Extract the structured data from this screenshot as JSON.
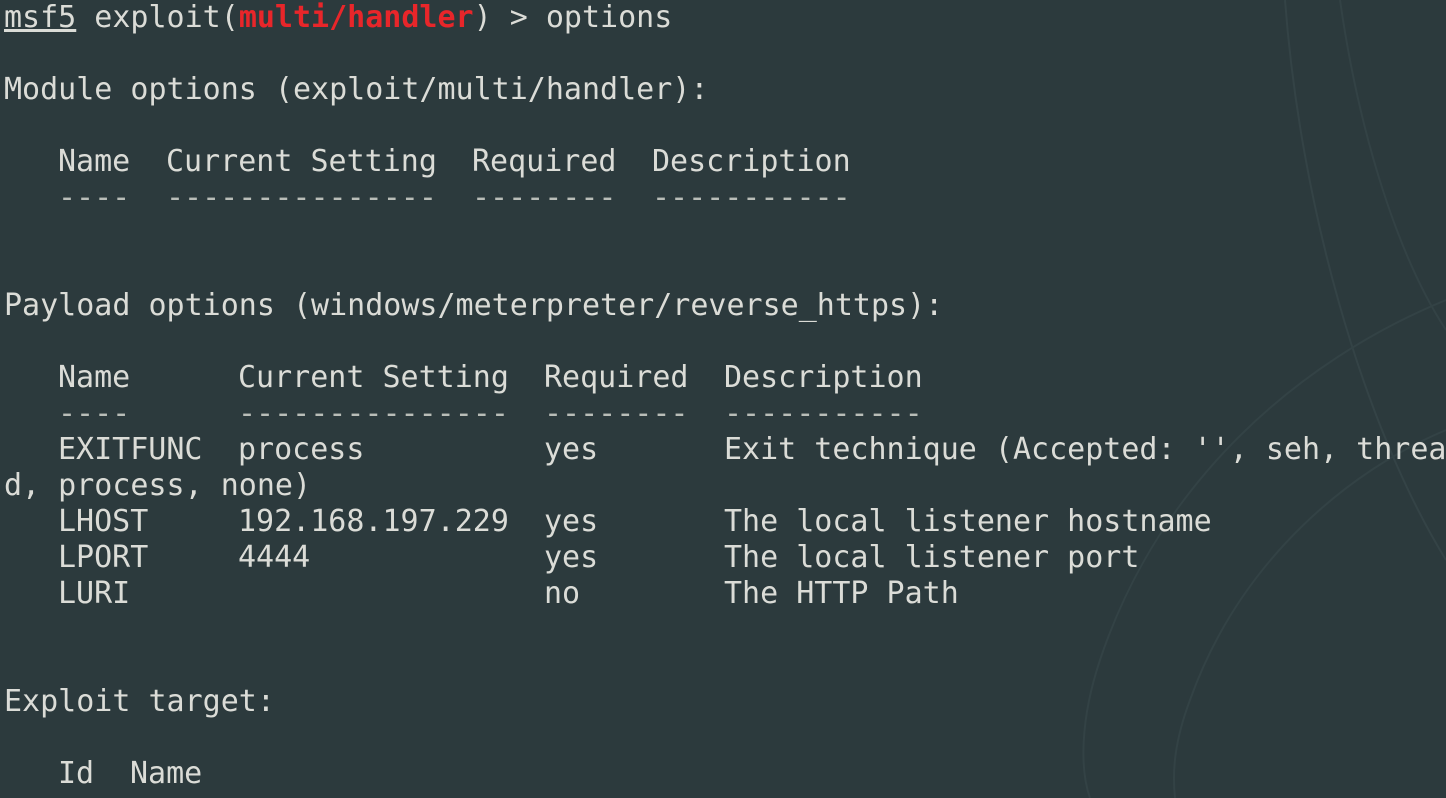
{
  "prompt": {
    "name": "msf5",
    "context_prefix": " exploit(",
    "module": "multi/handler",
    "context_suffix": ") > ",
    "command": "options"
  },
  "module_options": {
    "heading": "Module options (exploit/multi/handler):",
    "columns": [
      "Name",
      "Current Setting",
      "Required",
      "Description"
    ],
    "underlines": [
      "----",
      "---------------",
      "--------",
      "-----------"
    ],
    "rows": []
  },
  "payload_options": {
    "heading": "Payload options (windows/meterpreter/reverse_https):",
    "columns": [
      "Name",
      "Current Setting",
      "Required",
      "Description"
    ],
    "underlines": [
      "----",
      "---------------",
      "--------",
      "-----------"
    ],
    "rows": [
      {
        "name": "EXITFUNC",
        "setting": "process",
        "required": "yes",
        "description": "Exit technique (Accepted: '', seh, threa",
        "wrap": "d, process, none)"
      },
      {
        "name": "LHOST",
        "setting": "192.168.197.229",
        "required": "yes",
        "description": "The local listener hostname"
      },
      {
        "name": "LPORT",
        "setting": "4444",
        "required": "yes",
        "description": "The local listener port"
      },
      {
        "name": "LURI",
        "setting": "",
        "required": "no",
        "description": "The HTTP Path"
      }
    ]
  },
  "exploit_target": {
    "heading": "Exploit target:",
    "columns": [
      "Id",
      "Name"
    ]
  },
  "theme": {
    "background": "#2c3a3d",
    "text": "#dbdcd7",
    "module_accent": "#e8262a"
  }
}
